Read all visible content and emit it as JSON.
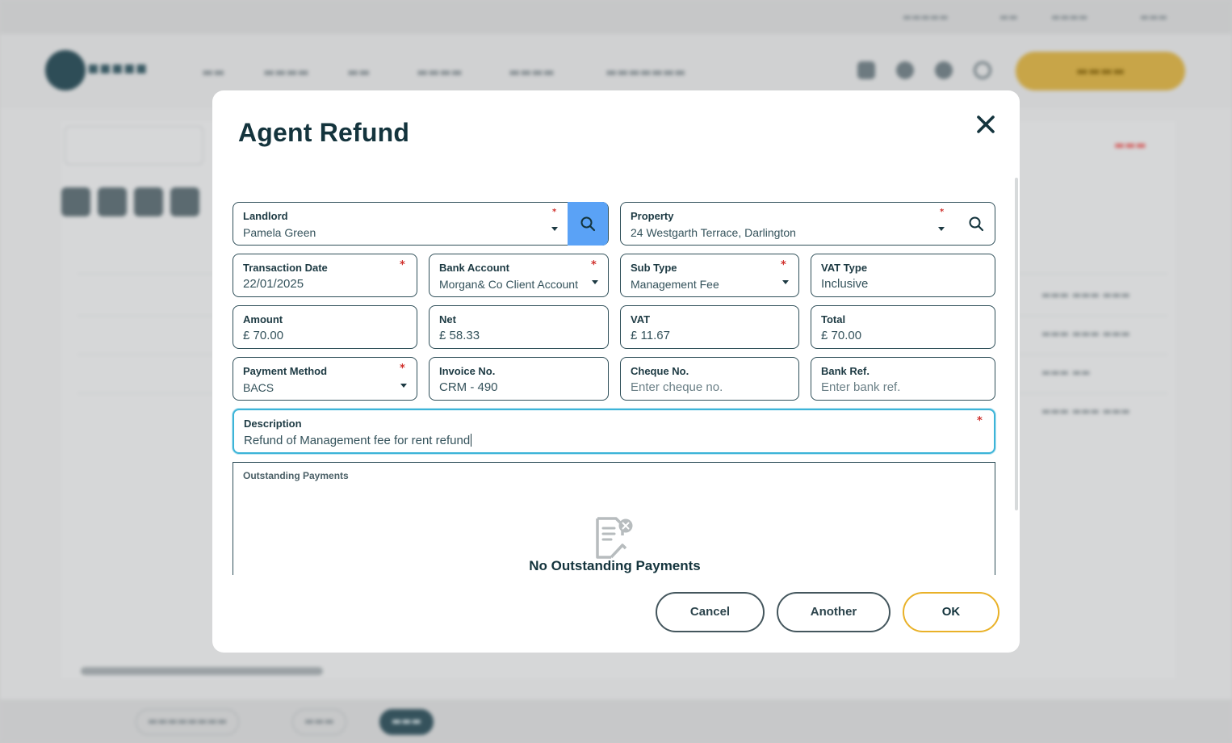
{
  "modal": {
    "title": "Agent Refund"
  },
  "fields": {
    "landlord": {
      "label": "Landlord",
      "value": "Pamela Green"
    },
    "property": {
      "label": "Property",
      "value": "24 Westgarth Terrace, Darlington"
    },
    "transaction_date": {
      "label": "Transaction Date",
      "value": "22/01/2025"
    },
    "bank_account": {
      "label": "Bank Account",
      "value": "Morgan& Co Client Account"
    },
    "sub_type": {
      "label": "Sub Type",
      "value": "Management Fee"
    },
    "vat_type": {
      "label": "VAT Type",
      "value": "Inclusive"
    },
    "amount": {
      "label": "Amount",
      "value": "£ 70.00"
    },
    "net": {
      "label": "Net",
      "value": "£ 58.33"
    },
    "vat": {
      "label": "VAT",
      "value": "£ 11.67"
    },
    "total": {
      "label": "Total",
      "value": "£ 70.00"
    },
    "payment_method": {
      "label": "Payment Method",
      "value": "BACS"
    },
    "invoice_no": {
      "label": "Invoice No.",
      "value": "CRM - 490"
    },
    "cheque_no": {
      "label": "Cheque No.",
      "placeholder": "Enter cheque no."
    },
    "bank_ref": {
      "label": "Bank Ref.",
      "placeholder": "Enter bank ref."
    },
    "description": {
      "label": "Description",
      "value": "Refund of Management fee for rent refund"
    },
    "required_mark": "*"
  },
  "outstanding": {
    "label": "Outstanding Payments",
    "empty_text": "No Outstanding Payments"
  },
  "buttons": {
    "cancel": "Cancel",
    "another": "Another",
    "ok": "OK"
  },
  "icons": {
    "close": "close-icon",
    "search": "search-icon",
    "caret": "chevron-down-icon",
    "empty": "document-x-icon"
  },
  "colors": {
    "primary_text": "#14343d",
    "field_border": "#2f4f59",
    "search_accent": "#5aa2f6",
    "required": "#d0302c",
    "focus": "#3cb4d8",
    "ok_border": "#e9b128"
  }
}
